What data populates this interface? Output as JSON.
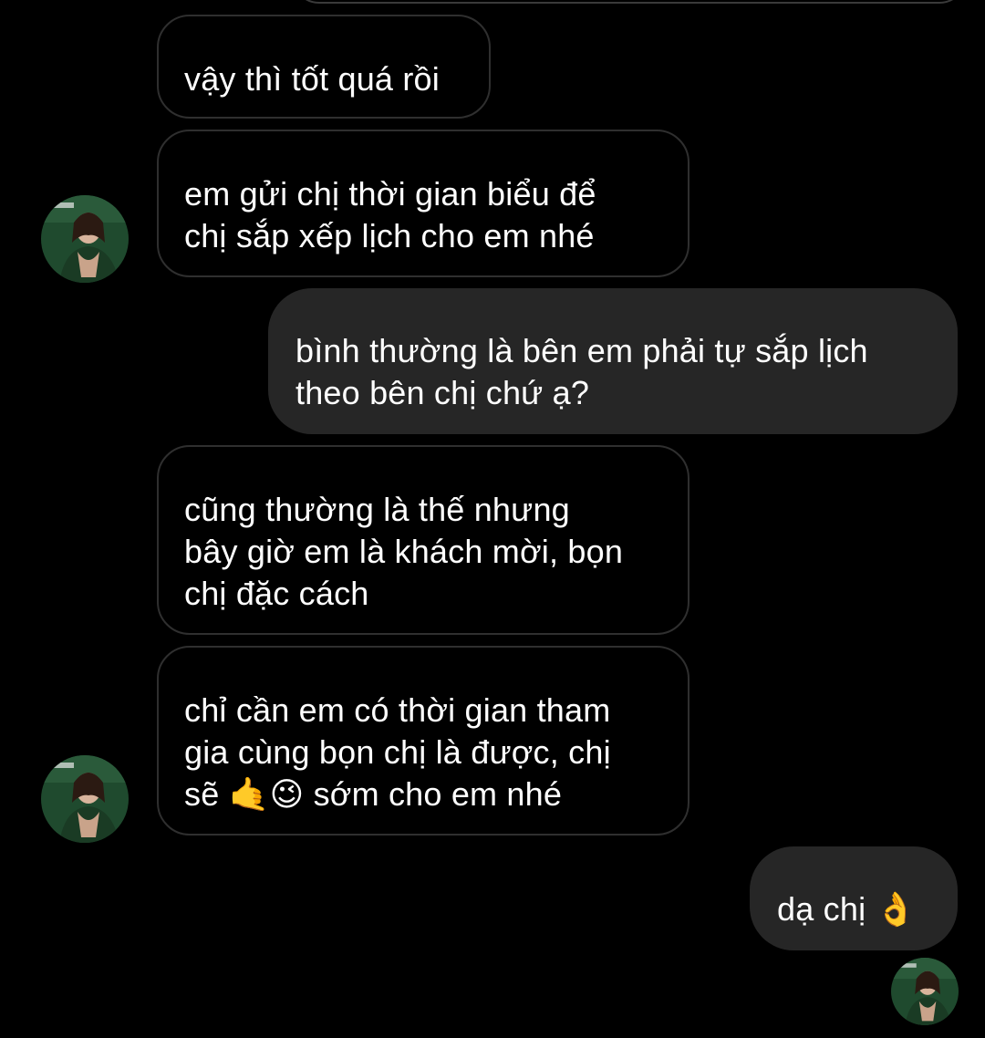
{
  "conversation": {
    "messages": [
      {
        "direction": "incoming",
        "text": "vậy thì tốt quá rồi"
      },
      {
        "direction": "incoming",
        "text": "em gửi chị thời gian biểu để\nchị sắp xếp lịch cho em nhé"
      },
      {
        "direction": "outgoing",
        "text": "bình thường là bên em phải tự sắp lịch\ntheo bên chị chứ ạ?"
      },
      {
        "direction": "incoming",
        "text": "cũng thường là thế nhưng\nbây giờ em là khách mời, bọn\nchị đặc cách"
      },
      {
        "direction": "incoming",
        "text": "chỉ cần em có thời gian tham\ngia cùng bọn chị là được, chị\nsẽ 🤙😉 sớm cho em nhé"
      },
      {
        "direction": "outgoing",
        "text": "dạ chị 👌"
      }
    ]
  },
  "colors": {
    "background": "#000000",
    "incoming_border": "#2f2f2f",
    "outgoing_bubble": "#262626",
    "text": "#ffffff",
    "avatar_green": "#1f4a2e"
  },
  "icons": {
    "avatar": "profile-photo-avatar"
  }
}
